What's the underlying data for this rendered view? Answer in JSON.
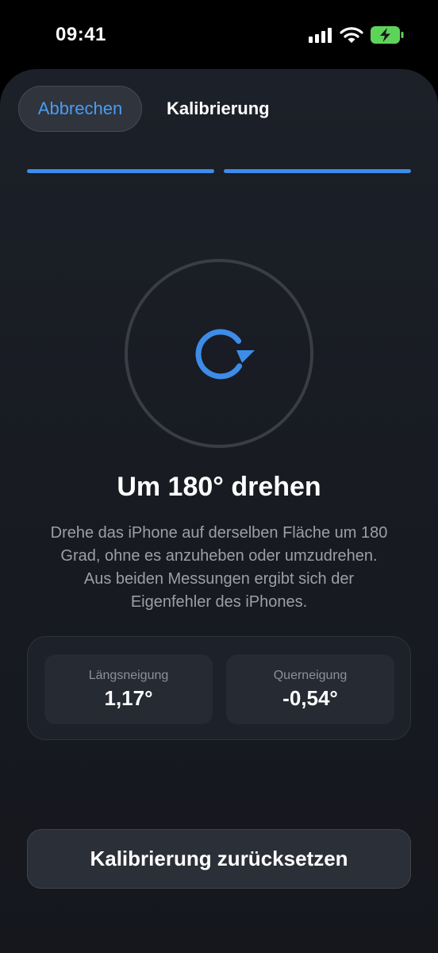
{
  "status_bar": {
    "time": "09:41",
    "icons": [
      "cellular-signal-icon",
      "wifi-icon",
      "battery-charging-icon"
    ],
    "battery_color": "#5ed35a"
  },
  "nav": {
    "cancel_label": "Abbrechen",
    "title": "Kalibrierung"
  },
  "steps": {
    "total": 2,
    "active": 2,
    "color": "#3d8de8"
  },
  "step": {
    "icon": "rotate-clockwise-icon",
    "icon_color": "#3d8de8",
    "title": "Um 180° drehen",
    "description_lines": [
      "Drehe das iPhone auf derselben Fläche um 180",
      "Grad, ohne es anzuheben oder umzudrehen.",
      "Aus beiden Messungen ergibt sich der",
      "Eigenfehler des iPhones."
    ]
  },
  "readings": {
    "pitch_label": "Längsneigung",
    "pitch_value": "1,17°",
    "roll_label": "Querneigung",
    "roll_value": "-0,54°"
  },
  "actions": {
    "reset_label": "Kalibrierung zurücksetzen"
  },
  "colors": {
    "accent": "#3d8de8",
    "background": "#181b22"
  }
}
